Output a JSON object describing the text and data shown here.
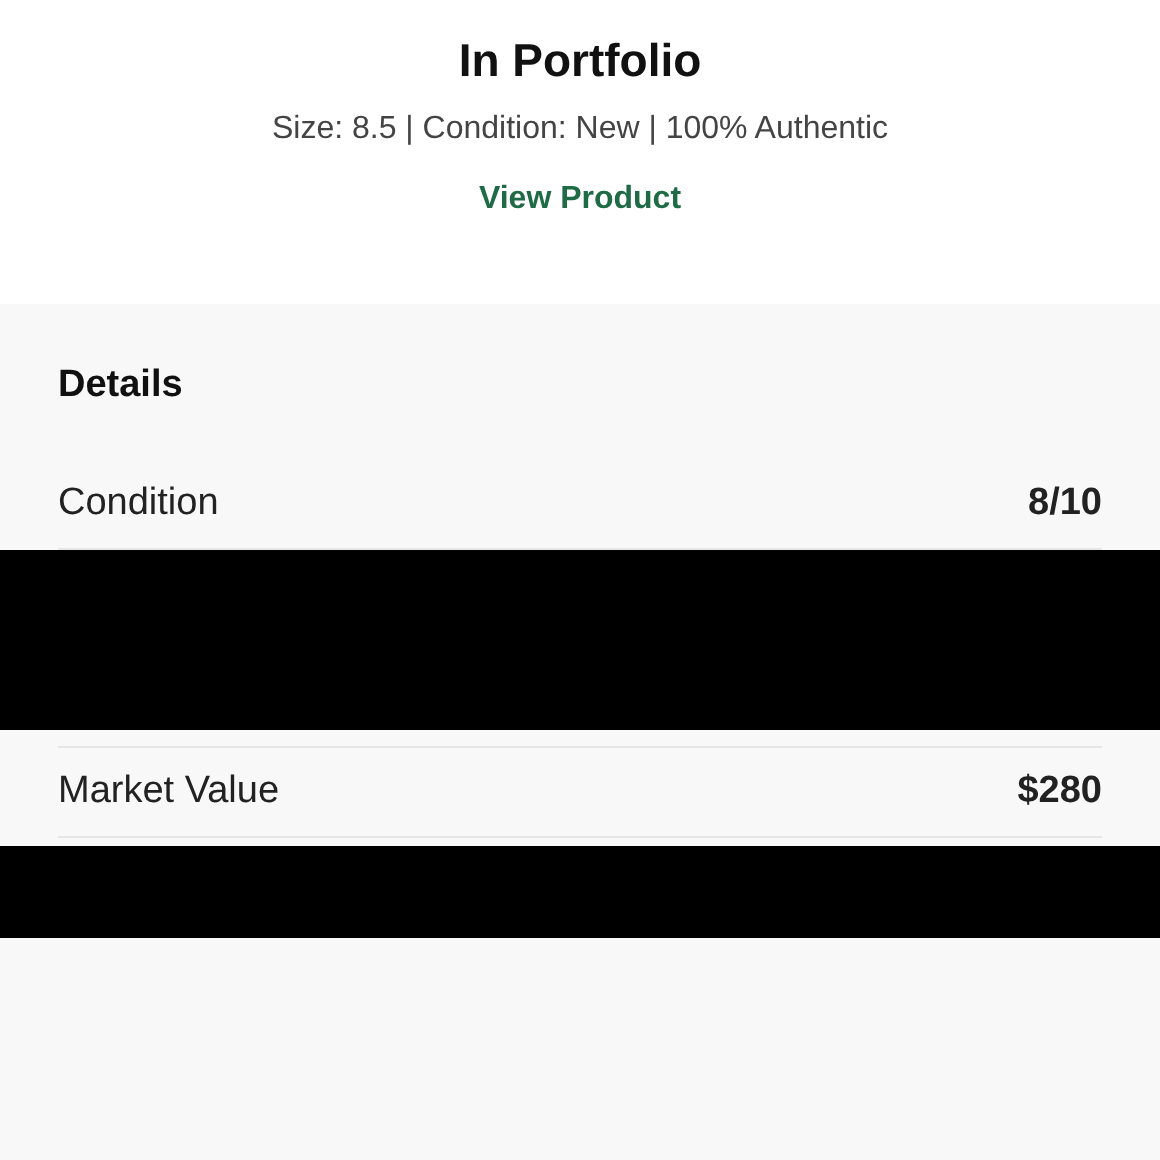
{
  "header": {
    "title": "In Portfolio",
    "subtitle": "Size: 8.5 | Condition: New | 100% Authentic",
    "link": "View Product"
  },
  "details": {
    "heading": "Details",
    "rows": [
      {
        "kind": "field",
        "label": "Condition",
        "value": "8/10"
      },
      {
        "kind": "redacted"
      },
      {
        "kind": "field",
        "label": "Market Value",
        "value": "$280"
      },
      {
        "kind": "redacted"
      }
    ]
  }
}
